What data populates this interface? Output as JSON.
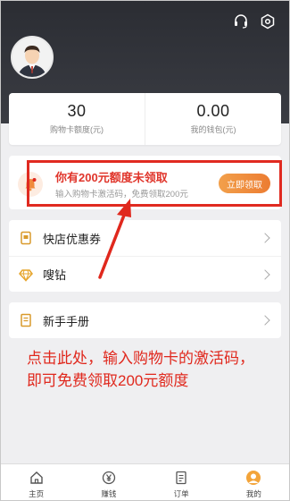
{
  "stats": [
    {
      "value": "30",
      "label": "购物卡额度(元)"
    },
    {
      "value": "0.00",
      "label": "我的钱包(元)"
    }
  ],
  "promo": {
    "title": "你有200元额度未领取",
    "subtitle": "输入购物卡激活码，免费领取200元",
    "button": "立即领取"
  },
  "menu": {
    "group1": [
      {
        "label": "快店优惠券",
        "icon": "coupon-icon"
      },
      {
        "label": "嗖钻",
        "icon": "diamond-icon"
      }
    ],
    "group2": [
      {
        "label": "新手手册",
        "icon": "manual-icon"
      }
    ]
  },
  "annotation": "点击此处，输入购物卡的激活码，即可免费领取200元额度",
  "tabs": [
    {
      "label": "主页",
      "icon": "home-icon"
    },
    {
      "label": "赚钱",
      "icon": "yen-icon"
    },
    {
      "label": "订单",
      "icon": "order-icon"
    },
    {
      "label": "我的",
      "icon": "profile-icon"
    }
  ],
  "colors": {
    "accent_red": "#e0281d",
    "button_orange": "#ec7c32",
    "header_dark": "#2b2d33"
  }
}
